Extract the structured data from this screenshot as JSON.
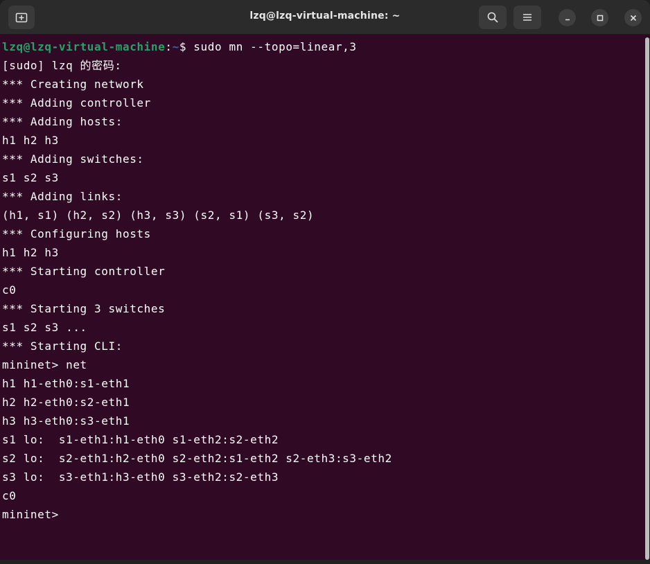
{
  "window": {
    "title": "lzq@lzq-virtual-machine: ~"
  },
  "icons": {
    "new_tab": "new-tab-icon",
    "search": "search-icon",
    "menu": "hamburger-menu-icon",
    "minimize": "minimize-icon",
    "maximize": "maximize-icon",
    "close": "close-icon"
  },
  "colors": {
    "terminal_bg": "#300a24",
    "titlebar_bg": "#2b2b2b",
    "prompt_user": "#26a269",
    "prompt_path": "#3465a4",
    "text": "#ffffff"
  },
  "prompt": {
    "user_host": "lzq@lzq-virtual-machine",
    "colon": ":",
    "path": "~",
    "symbol": "$ ",
    "command": "sudo mn --topo=linear,3"
  },
  "output_lines": [
    "[sudo] lzq 的密码:",
    "*** Creating network",
    "*** Adding controller",
    "*** Adding hosts:",
    "h1 h2 h3",
    "*** Adding switches:",
    "s1 s2 s3",
    "*** Adding links:",
    "(h1, s1) (h2, s2) (h3, s3) (s2, s1) (s3, s2)",
    "*** Configuring hosts",
    "h1 h2 h3",
    "*** Starting controller",
    "c0",
    "*** Starting 3 switches",
    "s1 s2 s3 ...",
    "*** Starting CLI:",
    "mininet> net",
    "h1 h1-eth0:s1-eth1",
    "h2 h2-eth0:s2-eth1",
    "h3 h3-eth0:s3-eth1",
    "s1 lo:  s1-eth1:h1-eth0 s1-eth2:s2-eth2",
    "s2 lo:  s2-eth1:h2-eth0 s2-eth2:s1-eth2 s2-eth3:s3-eth2",
    "s3 lo:  s3-eth1:h3-eth0 s3-eth2:s2-eth3",
    "c0",
    "mininet>"
  ]
}
